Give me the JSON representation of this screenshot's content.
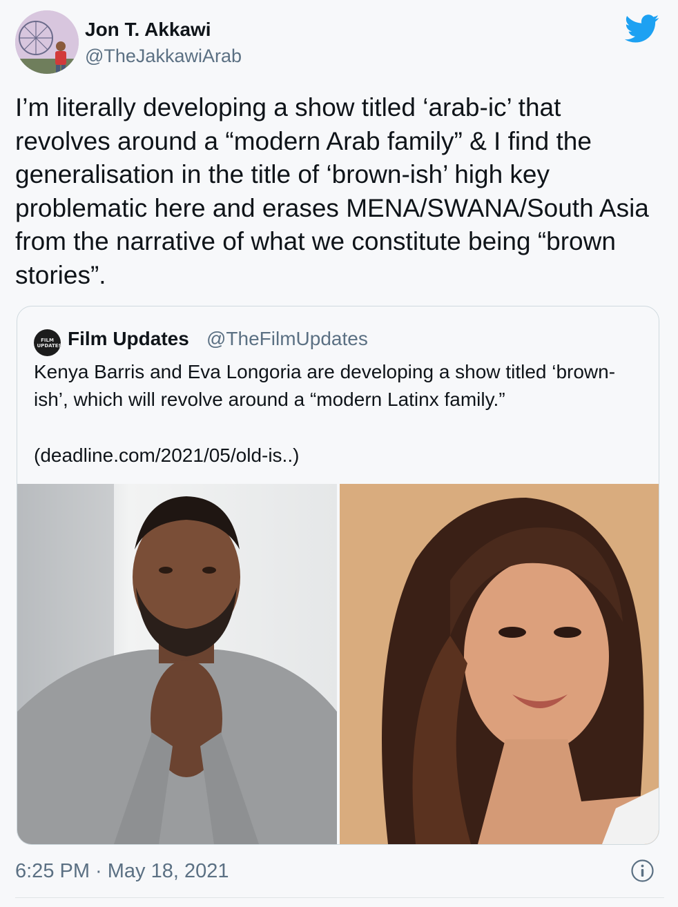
{
  "author": {
    "name": "Jon T. Akkawi",
    "handle": "@TheJakkawiArab"
  },
  "tweet": {
    "text": "I’m literally developing a show titled ‘arab-ic’ that revolves around a “modern Arab family” & I find the generalisation in the title of ‘brown-ish’ high key problematic here and erases MENA/SWANA/South Asia from the narrative of what we constitute being “brown stories”.",
    "timestamp": "6:25 PM · May 18, 2021"
  },
  "quote": {
    "avatar_text": "FILM UPDATES",
    "name": "Film Updates",
    "handle": "@TheFilmUpdates",
    "text": "Kenya Barris and Eva Longoria are developing a show titled ‘brown-ish’, which will revolve around a “modern Latinx family.”",
    "link": "(deadline.com/2021/05/old-is..)"
  },
  "icons": {
    "brand": "twitter-bird-icon",
    "info": "info-icon"
  },
  "colors": {
    "twitter_blue": "#1da1f2",
    "secondary_text": "#5b7083",
    "border": "#cfd9de"
  }
}
